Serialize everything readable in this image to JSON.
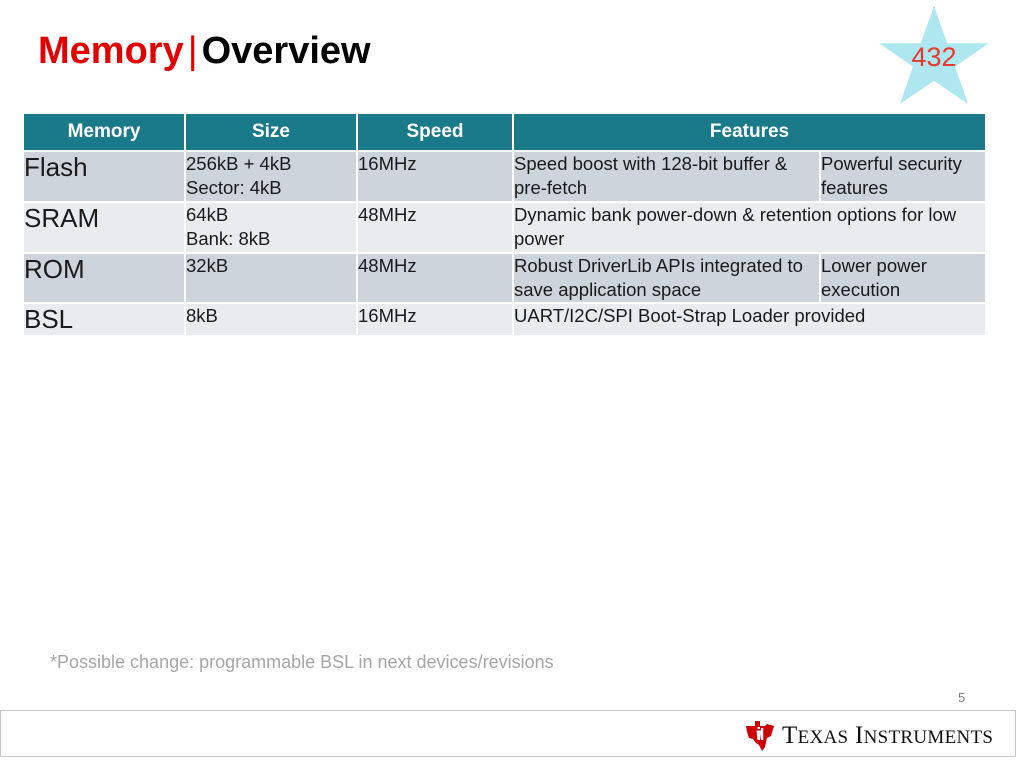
{
  "title": {
    "primary": "Memory",
    "separator": "|",
    "secondary": "Overview",
    "primary_color": "#E00000",
    "secondary_color": "#000000"
  },
  "badge": {
    "label": "432",
    "shape": "star-icon",
    "fill_color": "#AEE7F0",
    "stroke_color": "#5BC8DC",
    "text_color": "#E23A2E"
  },
  "table": {
    "header_bg": "#1B7A8A",
    "header_text_color": "#FFFFFF",
    "row_dark_bg": "#CDD4DB",
    "row_light_bg": "#E9ECEE",
    "headers": [
      "Memory",
      "Size",
      "Speed",
      "Features"
    ],
    "rows": [
      {
        "name": "Flash",
        "size_line1": "256kB + 4kB",
        "size_line2": "Sector: 4kB",
        "speed": "16MHz",
        "feature": "Speed boost with 128-bit buffer & pre-fetch",
        "feature_extra": "Powerful security features"
      },
      {
        "name": "SRAM",
        "size_line1": "64kB",
        "size_line2": "Bank: 8kB",
        "speed": "48MHz",
        "feature": "Dynamic bank power-down & retention options for low power",
        "feature_extra": ""
      },
      {
        "name": "ROM",
        "size_line1": "32kB",
        "size_line2": "",
        "speed": "48MHz",
        "feature": "Robust DriverLib APIs integrated to save application space",
        "feature_extra": "Lower power execution"
      },
      {
        "name": "BSL",
        "size_line1": "8kB",
        "size_line2": "",
        "speed": "16MHz",
        "feature": "UART/I2C/SPI Boot-Strap Loader provided",
        "feature_extra": ""
      }
    ]
  },
  "footnote": "*Possible change: programmable BSL in next devices/revisions",
  "slide_number": "5",
  "footer": {
    "logo_text_first": "T",
    "logo_text_first_rest": "EXAS",
    "logo_text_second": "I",
    "logo_text_second_rest": "NSTRUMENTS",
    "logo_color": "#CC0000"
  }
}
